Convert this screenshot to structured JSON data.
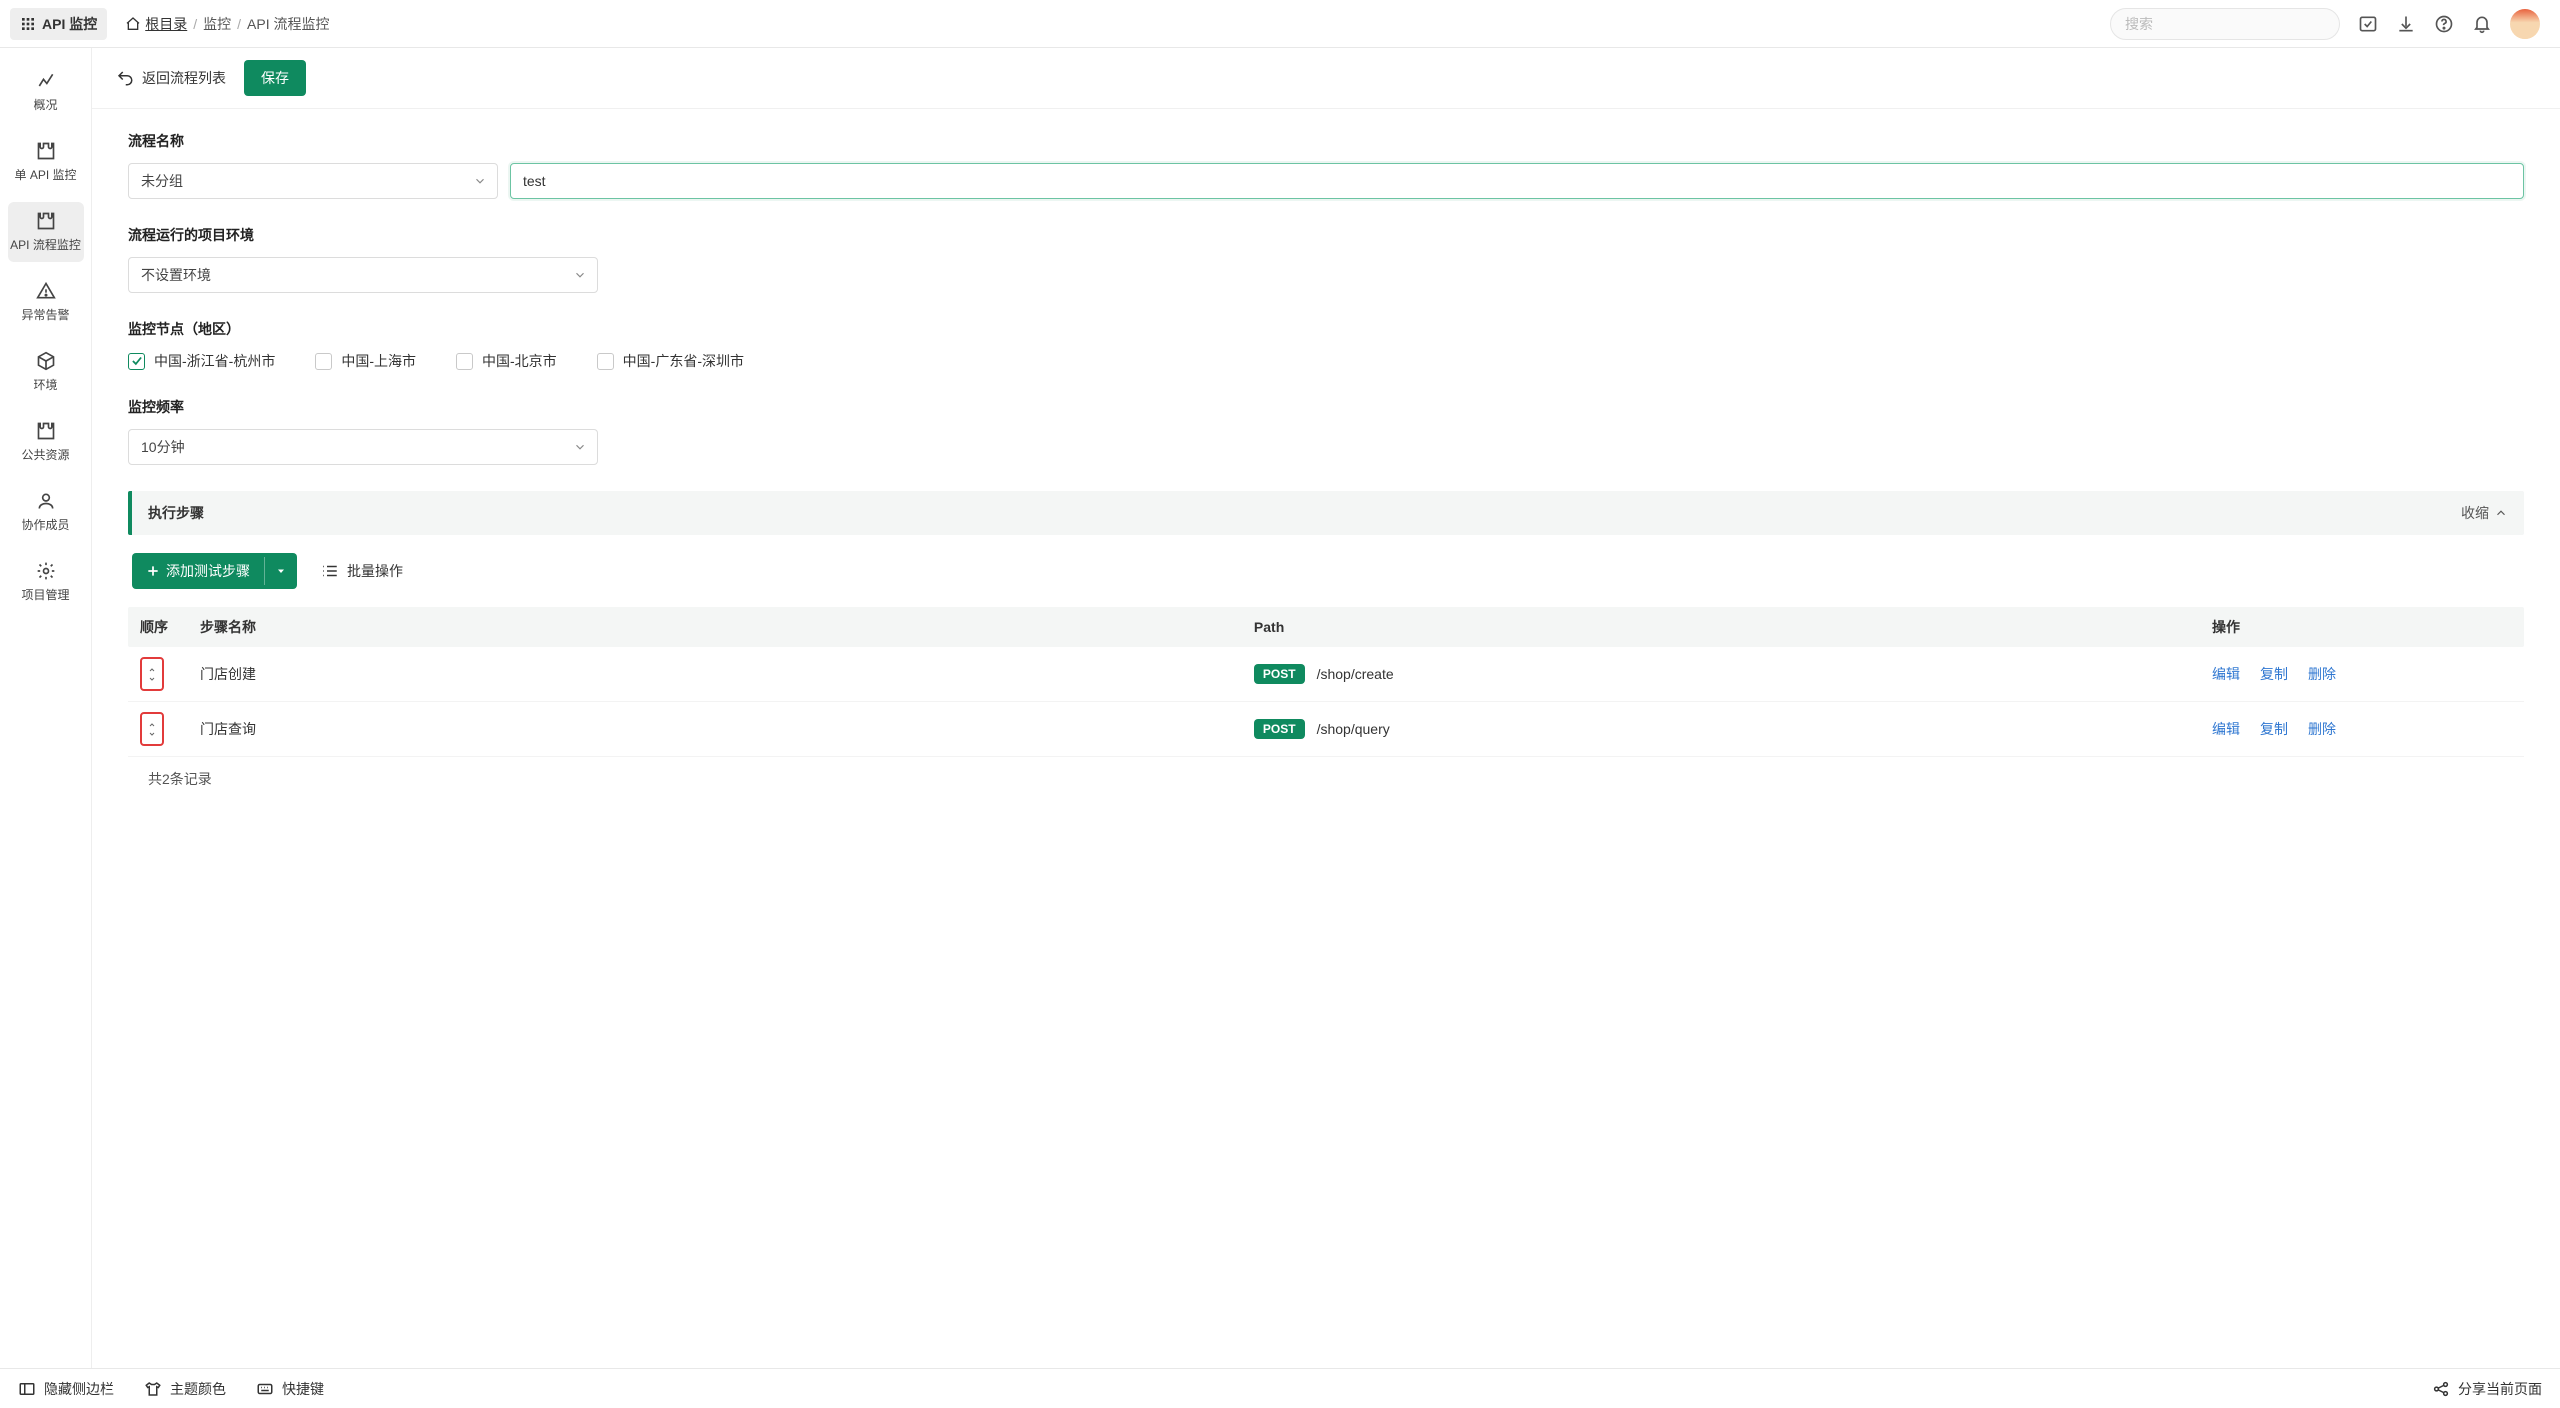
{
  "app": {
    "name": "API 监控"
  },
  "breadcrumb": {
    "root": "根目录",
    "mid": "监控",
    "leaf": "API 流程监控"
  },
  "topbar": {
    "search_placeholder": "搜索"
  },
  "sidebar": {
    "items": [
      {
        "label": "概况"
      },
      {
        "label": "单 API 监控"
      },
      {
        "label": "API 流程监控"
      },
      {
        "label": "异常告警"
      },
      {
        "label": "环境"
      },
      {
        "label": "公共资源"
      },
      {
        "label": "协作成员"
      },
      {
        "label": "项目管理"
      }
    ]
  },
  "actions": {
    "back": "返回流程列表",
    "save": "保存"
  },
  "form": {
    "name_label": "流程名称",
    "group_value": "未分组",
    "name_value": "test",
    "env_label": "流程运行的项目环境",
    "env_value": "不设置环境",
    "nodes_label": "监控节点（地区）",
    "nodes": {
      "hangzhou": "中国-浙江省-杭州市",
      "shanghai": "中国-上海市",
      "beijing": "中国-北京市",
      "shenzhen": "中国-广东省-深圳市"
    },
    "freq_label": "监控频率",
    "freq_value": "10分钟"
  },
  "section": {
    "title": "执行步骤",
    "collapse": "收缩"
  },
  "steps_tools": {
    "add": "添加测试步骤",
    "batch": "批量操作"
  },
  "table": {
    "headers": {
      "order": "顺序",
      "name": "步骤名称",
      "path": "Path",
      "ops": "操作"
    },
    "rows": [
      {
        "name": "门店创建",
        "method": "POST",
        "path": "/shop/create"
      },
      {
        "name": "门店查询",
        "method": "POST",
        "path": "/shop/query"
      }
    ],
    "ops": {
      "edit": "编辑",
      "copy": "复制",
      "del": "删除"
    },
    "summary": "共2条记录"
  },
  "footer": {
    "hide": "隐藏侧边栏",
    "theme": "主题颜色",
    "shortcut": "快捷键",
    "share": "分享当前页面"
  }
}
